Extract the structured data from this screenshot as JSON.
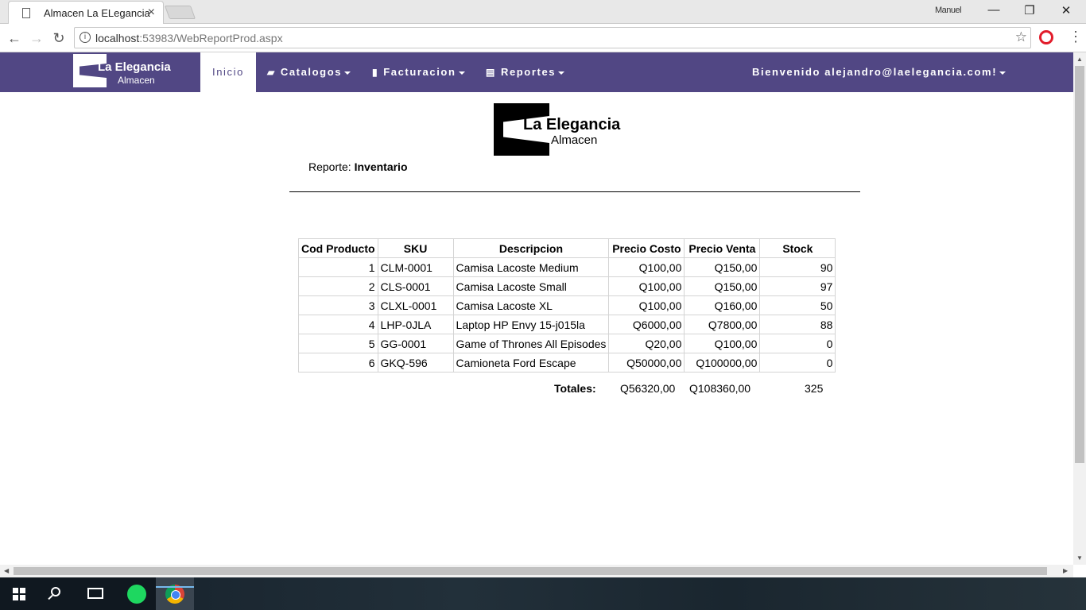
{
  "browser": {
    "tab_title": "Almacen La ELegancia",
    "tab_close": "×",
    "user": "Manuel",
    "url_host": "localhost",
    "url_path": ":53983/WebReportProd.aspx",
    "minimize": "—",
    "restore": "❐",
    "close": "✕"
  },
  "navbar": {
    "brand_title": "La Elegancia",
    "brand_subtitle": "Almacen",
    "items": [
      {
        "label": "Inicio"
      },
      {
        "label": "Catalogos"
      },
      {
        "label": "Facturacion"
      },
      {
        "label": "Reportes"
      }
    ],
    "user_menu": "Bienvenido alejandro@laelegancia.com!"
  },
  "report": {
    "logo_title": "La Elegancia",
    "logo_subtitle": "Almacen",
    "label": "Reporte:",
    "name": "Inventario",
    "columns": [
      "Cod Producto",
      "SKU",
      "Descripcion",
      "Precio Costo",
      "Precio Venta",
      "Stock"
    ],
    "rows": [
      [
        "1",
        "CLM-0001",
        "Camisa Lacoste Medium",
        "Q100,00",
        "Q150,00",
        "90"
      ],
      [
        "2",
        "CLS-0001",
        "Camisa Lacoste Small",
        "Q100,00",
        "Q150,00",
        "97"
      ],
      [
        "3",
        "CLXL-0001",
        "Camisa Lacoste XL",
        "Q100,00",
        "Q160,00",
        "50"
      ],
      [
        "4",
        "LHP-0JLA",
        "Laptop HP Envy 15-j015la",
        "Q6000,00",
        "Q7800,00",
        "88"
      ],
      [
        "5",
        "GG-0001",
        "Game of Thrones All Episodes",
        "Q20,00",
        "Q100,00",
        "0"
      ],
      [
        "6",
        "GKQ-596",
        "Camioneta Ford Escape",
        "Q50000,00",
        "Q100000,00",
        "0"
      ]
    ],
    "totals": {
      "label": "Totales:",
      "costo": "Q56320,00",
      "venta": "Q108360,00",
      "stock": "325"
    }
  },
  "colors": {
    "navbar": "#514784",
    "accent_taskbar": "#76b9ed"
  },
  "icons": [
    "doc-icon",
    "back-icon",
    "forward-icon",
    "reload-icon",
    "info-icon",
    "star-icon",
    "opera-icon",
    "menu-icon",
    "folder-open-icon",
    "file-icon",
    "list-icon",
    "windows-start-icon",
    "search-icon",
    "task-view-icon",
    "spotify-icon",
    "chrome-icon"
  ]
}
